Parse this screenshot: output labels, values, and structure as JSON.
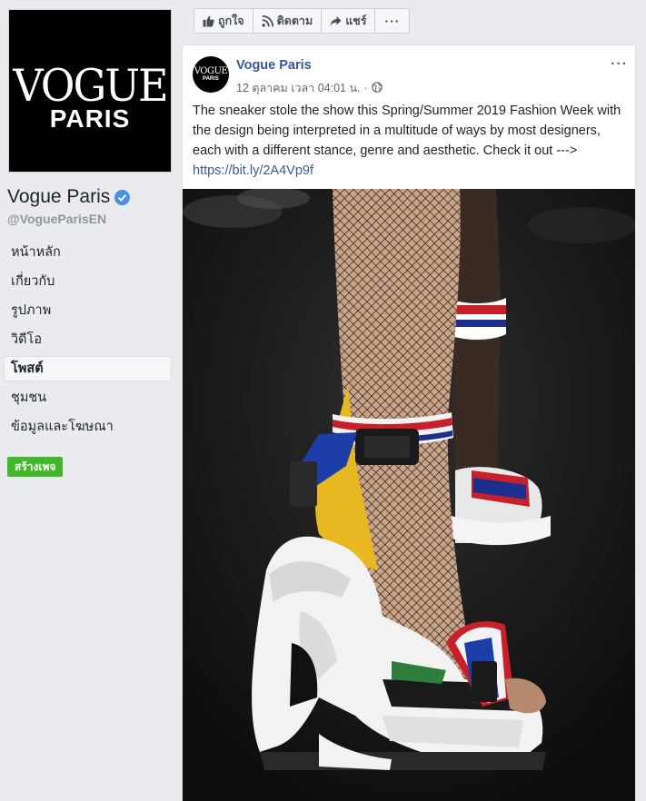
{
  "page": {
    "name": "Vogue Paris",
    "handle": "@VogueParisEN",
    "logo_top": "VOGUE",
    "logo_bottom": "PARIS"
  },
  "nav": {
    "items": [
      {
        "label": "หน้าหลัก"
      },
      {
        "label": "เกี่ยวกับ"
      },
      {
        "label": "รูปภาพ"
      },
      {
        "label": "วิดีโอ"
      },
      {
        "label": "โพสต์"
      },
      {
        "label": "ชุมชน"
      },
      {
        "label": "ข้อมูลและโฆษณา"
      }
    ],
    "create_page_label": "สร้างเพจ"
  },
  "actions": {
    "like_label": "ถูกใจ",
    "follow_label": "ติดตาม",
    "share_label": "แชร์",
    "more_label": "···"
  },
  "post": {
    "author": "Vogue Paris",
    "timestamp": "12 ตุลาคม เวลา 04:01 น.",
    "options_label": "···",
    "text": "The sneaker stole the show this Spring/Summer 2019 Fashion Week with the design being interpreted in a multitude of ways by most designers, each with a different stance, genre and aesthetic. Check it out ---> ",
    "link": "https://bit.ly/2A4Vp9f"
  },
  "colors": {
    "brand_blue": "#365899",
    "verified_blue": "#4a90e2",
    "create_green": "#42b72a",
    "background": "#e9ebee"
  }
}
